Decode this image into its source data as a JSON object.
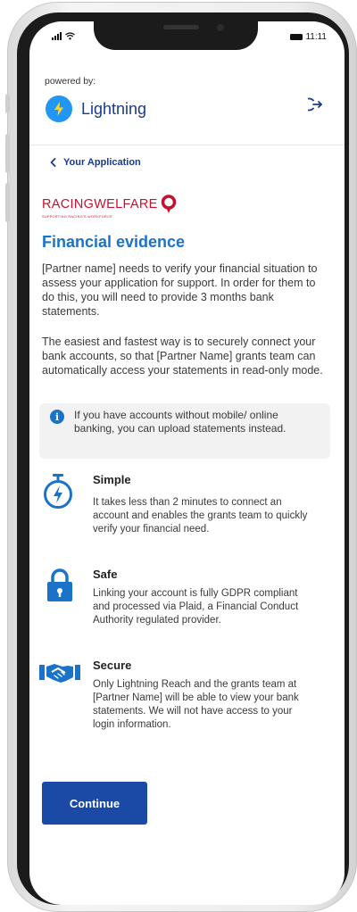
{
  "status_bar": {
    "time": "11:11"
  },
  "header": {
    "powered_by": "powered by:",
    "brand_name": "Lightning",
    "icons": {
      "brand": "lightning-bolt-icon",
      "logout": "logout-icon"
    }
  },
  "nav": {
    "back_label": "Your Application",
    "back_icon": "chevron-left-icon"
  },
  "partner": {
    "name": "RACINGWELFARE",
    "tagline": "SUPPORTING RACING'S WORKFORCE",
    "color": "#c8102e"
  },
  "page": {
    "title": "Financial evidence",
    "intro": "[Partner name] needs to verify your financial situation to assess your application for support. In order for them to do this, you will need to provide 3 months bank statements.",
    "easiest": "The easiest and fastest way is to securely connect your bank accounts, so that [Partner Name] grants team can automatically access your statements in read-only mode.",
    "info_box": "If you have accounts without mobile/ online banking, you can upload statements instead."
  },
  "features": [
    {
      "icon": "stopwatch-icon",
      "title": "Simple",
      "description": "It takes less than 2 minutes to connect an account and enables the grants team to quickly verify your financial need."
    },
    {
      "icon": "padlock-icon",
      "title": "Safe",
      "description": "Linking your account is fully GDPR compliant and processed via Plaid, a Financial Conduct Authority regulated provider."
    },
    {
      "icon": "handshake-icon",
      "title": "Secure",
      "description": "Only Lightning Reach and the grants team at [Partner Name] will be able to view your bank statements. We will not have access to your login information."
    }
  ],
  "actions": {
    "continue_label": "Continue"
  },
  "colors": {
    "primary": "#1a4aa6",
    "accent": "#1a73c8",
    "brand_blue": "#2196f3",
    "partner_red": "#c8102e"
  }
}
